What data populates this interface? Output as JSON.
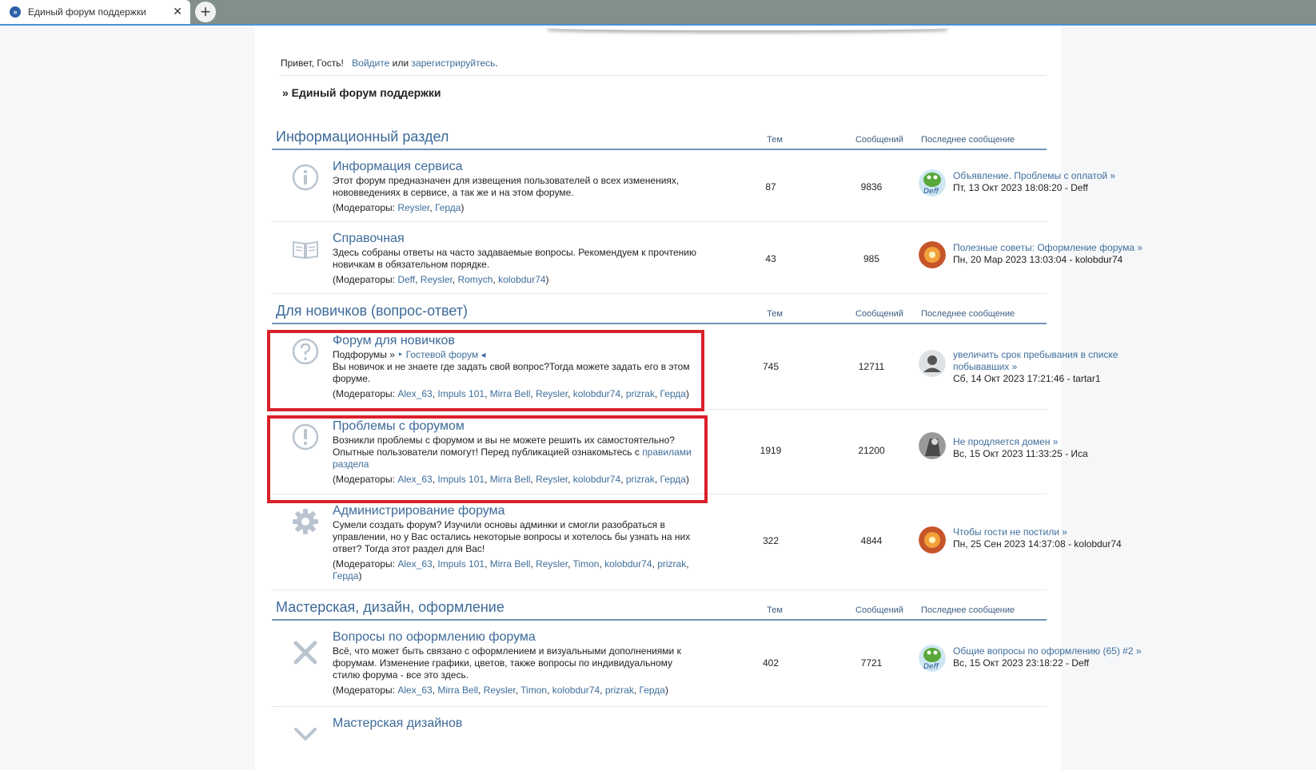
{
  "browser": {
    "tab_title": "Единый форум поддержки",
    "tab_close": "✕",
    "new_tab": "+"
  },
  "welcome": {
    "greeting": "Привет, Гость!",
    "login": "Войдите",
    "or": "или",
    "register": "зарегистрируйтесь",
    "dot": "."
  },
  "breadcrumb": "» Единый форум поддержки",
  "columns": {
    "topics": "Тем",
    "posts": "Сообщений",
    "last": "Последнее сообщение"
  },
  "categories": [
    {
      "title": "Информационный раздел",
      "forums": [
        {
          "name": "Информация сервиса",
          "desc": "Этот форум предназначен для извещения пользователей о всех изменениях, нововведениях в сервисе, а так же и на этом форуме.",
          "mods_prefix": "(Модераторы: ",
          "mods": [
            "Reysler",
            "Герда"
          ],
          "mods_suffix": ")",
          "topics": "87",
          "posts": "9836",
          "last_title": "Объявление. Проблемы с оплатой »",
          "last_meta": "Пт, 13 Окт 2023 18:08:20 - Deff"
        },
        {
          "name": "Справочная",
          "desc": "Здесь собраны ответы на часто задаваемые вопросы. Рекомендуем к прочтению новичкам в обязательном порядке.",
          "mods_prefix": "(Модераторы: ",
          "mods": [
            "Deff",
            "Reysler",
            "Romych",
            "kolobdur74"
          ],
          "mods_suffix": ")",
          "topics": "43",
          "posts": "985",
          "last_title": "Полезные советы: Оформление форума »",
          "last_meta": "Пн, 20 Мар 2023 13:03:04 - kolobdur74"
        }
      ]
    },
    {
      "title": "Для новичков (вопрос-ответ)",
      "forums": [
        {
          "name": "Форум для новичков",
          "subforums_label": "Подфорумы »",
          "subforum": "‣ Гостевой форум ◂",
          "desc": "Вы новичок и не знаете где задать свой вопрос?Тогда можете задать его в этом форуме.",
          "mods_prefix": "(Модераторы: ",
          "mods": [
            "Alex_63",
            "Impuls 101",
            "Mirra Bell",
            "Reysler",
            "kolobdur74",
            "prizrak",
            "Герда"
          ],
          "mods_suffix": ")",
          "topics": "745",
          "posts": "12711",
          "last_title": "увеличить срок пребывания в списке побывавших »",
          "last_meta": "Сб, 14 Окт 2023 17:21:46 - tartar1"
        },
        {
          "name": "Проблемы с форумом",
          "desc": "Возникли проблемы с форумом и вы не можете решить их самостоятельно? Опытные пользователи помогут! Перед публикацией ознакомьтесь с",
          "desc_link": "правилами раздела",
          "mods_prefix": "(Модераторы: ",
          "mods": [
            "Alex_63",
            "Impuls 101",
            "Mirra Bell",
            "Reysler",
            "kolobdur74",
            "prizrak",
            "Герда"
          ],
          "mods_suffix": ")",
          "topics": "1919",
          "posts": "21200",
          "last_title": "Не продляется домен »",
          "last_meta": "Вс, 15 Окт 2023 11:33:25 - Иса"
        },
        {
          "name": "Администрирование форума",
          "desc": "Сумели создать форум? Изучили основы админки и смогли разобраться в управлении, но у Вас остались некоторые вопросы и хотелось бы узнать на них ответ? Тогда этот раздел для Вас!",
          "mods_prefix": "(Модераторы: ",
          "mods": [
            "Alex_63",
            "Impuls 101",
            "Mirra Bell",
            "Reysler",
            "Timon",
            "kolobdur74",
            "prizrak",
            "Герда"
          ],
          "mods_suffix": ")",
          "topics": "322",
          "posts": "4844",
          "last_title": "Чтобы гости не постили »",
          "last_meta": "Пн, 25 Сен 2023 14:37:08 - kolobdur74"
        }
      ]
    },
    {
      "title": "Мастерская, дизайн, оформление",
      "forums": [
        {
          "name": "Вопросы по оформлению форума",
          "desc": "Всё, что может быть связано с оформлением и визуальными дополнениями к форумам. Изменение графики, цветов, также вопросы по индивидуальному стилю форума - все это здесь.",
          "mods_prefix": "(Модераторы: ",
          "mods": [
            "Alex_63",
            "Mirra Bell",
            "Reysler",
            "Timon",
            "kolobdur74",
            "prizrak",
            "Герда"
          ],
          "mods_suffix": ")",
          "topics": "402",
          "posts": "7721",
          "last_title": "Общие вопросы по оформлению (65) #2 »",
          "last_meta": "Вс, 15 Окт 2023 23:18:22 - Deff"
        },
        {
          "name": "Мастерская дизайнов"
        }
      ]
    }
  ],
  "colors": {
    "link": "#3f6e9b",
    "highlight": "#d9202b",
    "rule": "#6f94b8"
  }
}
